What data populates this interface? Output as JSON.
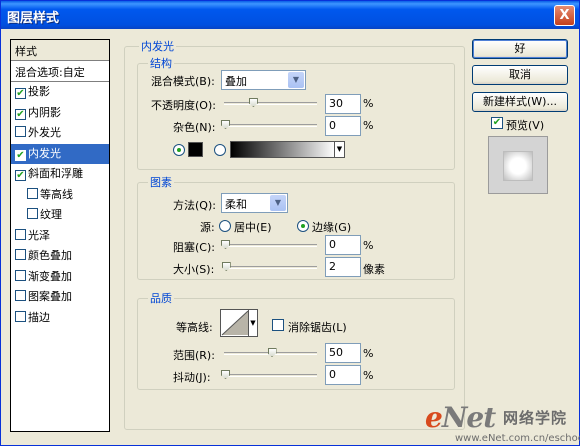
{
  "window": {
    "title": "图层样式",
    "close_glyph": "X"
  },
  "left_list": {
    "header": "样式",
    "blend": "混合选项:自定",
    "items": [
      {
        "label": "投影",
        "checked": true,
        "indent": false,
        "selected": false
      },
      {
        "label": "内阴影",
        "checked": true,
        "indent": false,
        "selected": false
      },
      {
        "label": "外发光",
        "checked": false,
        "indent": false,
        "selected": false
      },
      {
        "label": "内发光",
        "checked": true,
        "indent": false,
        "selected": true
      },
      {
        "label": "斜面和浮雕",
        "checked": true,
        "indent": false,
        "selected": false
      },
      {
        "label": "等高线",
        "checked": false,
        "indent": true,
        "selected": false
      },
      {
        "label": "纹理",
        "checked": false,
        "indent": true,
        "selected": false
      },
      {
        "label": "光泽",
        "checked": false,
        "indent": false,
        "selected": false
      },
      {
        "label": "颜色叠加",
        "checked": false,
        "indent": false,
        "selected": false
      },
      {
        "label": "渐变叠加",
        "checked": false,
        "indent": false,
        "selected": false
      },
      {
        "label": "图案叠加",
        "checked": false,
        "indent": false,
        "selected": false
      },
      {
        "label": "描边",
        "checked": false,
        "indent": false,
        "selected": false
      }
    ]
  },
  "inner_glow": {
    "title": "内发光",
    "structure": {
      "title": "结构",
      "blend_mode_label": "混合模式(B):",
      "blend_mode_value": "叠加",
      "opacity_label": "不透明度(O):",
      "opacity_value": "30",
      "opacity_unit": "%",
      "opacity_fraction": 0.3,
      "noise_label": "杂色(N):",
      "noise_value": "0",
      "noise_unit": "%",
      "noise_fraction": 0.0,
      "solid_color": "#000000",
      "gradient_from": "#000000",
      "gradient_to": "#ffffff"
    },
    "elements": {
      "title": "图素",
      "technique_label": "方法(Q):",
      "technique_value": "柔和",
      "source_label": "源:",
      "source_center": "居中(E)",
      "source_edge": "边缘(G)",
      "choke_label": "阻塞(C):",
      "choke_value": "0",
      "choke_unit": "%",
      "choke_fraction": 0.0,
      "size_label": "大小(S):",
      "size_value": "2",
      "size_unit": "像素",
      "size_fraction": 0.008
    },
    "quality": {
      "title": "品质",
      "contour_label": "等高线:",
      "antialias_label": "消除锯齿(L)",
      "range_label": "范围(R):",
      "range_value": "50",
      "range_unit": "%",
      "range_fraction": 0.5,
      "jitter_label": "抖动(J):",
      "jitter_value": "0",
      "jitter_unit": "%",
      "jitter_fraction": 0.0
    }
  },
  "buttons": {
    "ok": "好",
    "cancel": "取消",
    "new_style": "新建样式(W)...",
    "preview_label": "预览(V)",
    "preview_checked": true
  },
  "watermark": {
    "logo_e": "e",
    "logo_rest": "Net",
    "cn": "网络学院",
    "url": "www.eNet.com.cn/eschool"
  }
}
